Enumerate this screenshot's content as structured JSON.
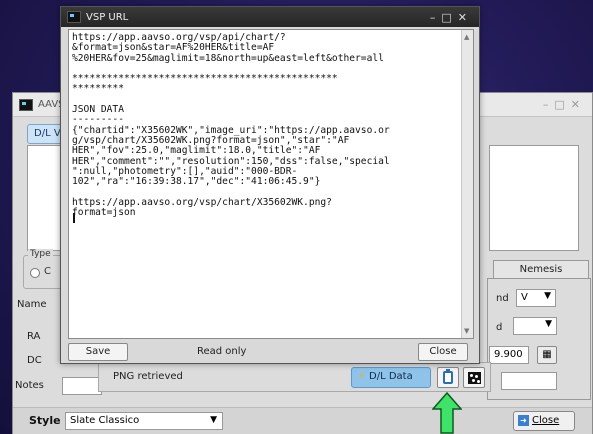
{
  "main_window": {
    "title": "AAVS",
    "tab_label": "D/L V",
    "type_group_label": "Type",
    "radio_label": "C",
    "labels": {
      "name": "Name",
      "ra": "RA",
      "dc": "DC",
      "notes": "Notes",
      "band": "nd",
      "d": "d"
    },
    "nemesis_tab": "Nemesis",
    "band_value": "V",
    "field_value": "9.900",
    "style_label": "Style",
    "style_value": "Slate Classico",
    "close_label": "Close"
  },
  "vsp_dialog": {
    "title": "VSP URL",
    "text": "https://app.aavso.org/vsp/api/chart/?\n&format=json&star=AF%20HER&title=AF\n%20HER&fov=25&maglimit=18&north=up&east=left&other=all\n\n**********************************************\n*********\n\nJSON DATA\n---------\n{\"chartid\":\"X35602WK\",\"image_uri\":\"https://app.aavso.or\ng/vsp/chart/X35602WK.png?format=json\",\"star\":\"AF\nHER\",\"fov\":25.0,\"maglimit\":18.0,\"title\":\"AF\nHER\",\"comment\":\"\",\"resolution\":150,\"dss\":false,\"special\n\":null,\"photometry\":[],\"auid\":\"000-BDR-\n102\",\"ra\":\"16:39:38.17\",\"dec\":\"41:06:45.9\"}\n\nhttps://app.aavso.org/vsp/chart/X35602WK.png?\nformat=json\n",
    "save_label": "Save",
    "status": "Read only",
    "close_label": "Close"
  },
  "status_strip": {
    "message": "PNG retrieved",
    "dl_button": "D/L Data"
  },
  "icons": [
    "app-icon",
    "minimize-icon",
    "maximize-icon",
    "close-icon",
    "clipboard-icon",
    "image-icon",
    "green-up-arrow-icon"
  ],
  "colors": {
    "accent": "#8fc3ea",
    "arrow": "#3fe36a",
    "desktop": "#231c5a"
  }
}
